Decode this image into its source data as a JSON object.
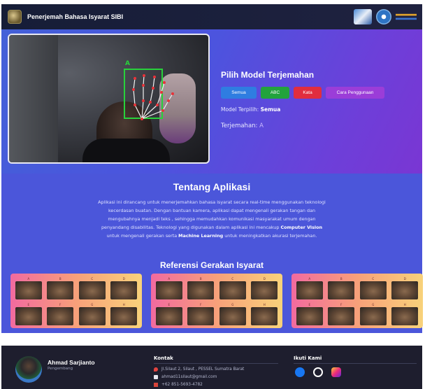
{
  "header": {
    "title": "Penerjemah Bahasa Isyarat SIBI"
  },
  "camera": {
    "detected_label": "A"
  },
  "panel": {
    "title": "Pilih Model Terjemahan",
    "buttons": [
      "Semua",
      "ABC",
      "Kata",
      "Cara Penggunaan"
    ],
    "model_label": "Model Terpilih:",
    "model_value": "Semua",
    "translation_label": "Terjemahan:",
    "translation_value": "A"
  },
  "about": {
    "title": "Tentang Aplikasi",
    "text_1": "Aplikasi ini dirancang untuk menerjemahkan bahasa isyarat secara real-time menggunakan teknologi kecerdasan buatan. Dengan bantuan kamera, aplikasi dapat mengenali gerakan tangan dan mengubahnya menjadi teks , sehingga memudahkan komunikasi masyarakat umum dengan penyandang disabilitas. Teknologi yang digunakan dalam aplikasi ini mencakup ",
    "strong_1": "Computer Vision",
    "text_2": " untuk mengenali gerakan serta ",
    "strong_2": "Machine Learning",
    "text_3": " untuk meningkatkan akurasi terjemahan."
  },
  "reference": {
    "title": "Referensi Gerakan Isyarat",
    "cards": [
      {
        "letters": [
          "A",
          "B",
          "C",
          "D",
          "E",
          "F",
          "G",
          "H"
        ]
      },
      {
        "letters": [
          "A",
          "B",
          "C",
          "D",
          "E",
          "F",
          "G",
          "H"
        ]
      },
      {
        "letters": [
          "A",
          "B",
          "C",
          "D",
          "E",
          "F",
          "G",
          "H"
        ]
      }
    ]
  },
  "footer": {
    "name": "Ahmad Sarjianto",
    "role": "Pengembang",
    "contact_title": "Kontak",
    "address": "Jl.Silaut 2, Silaut , PESSEL Sumatra Barat",
    "email": "ahmad11silaut@gmail.com",
    "phone": "+62 851-5693-4782",
    "follow_title": "Ikuti Kami"
  }
}
